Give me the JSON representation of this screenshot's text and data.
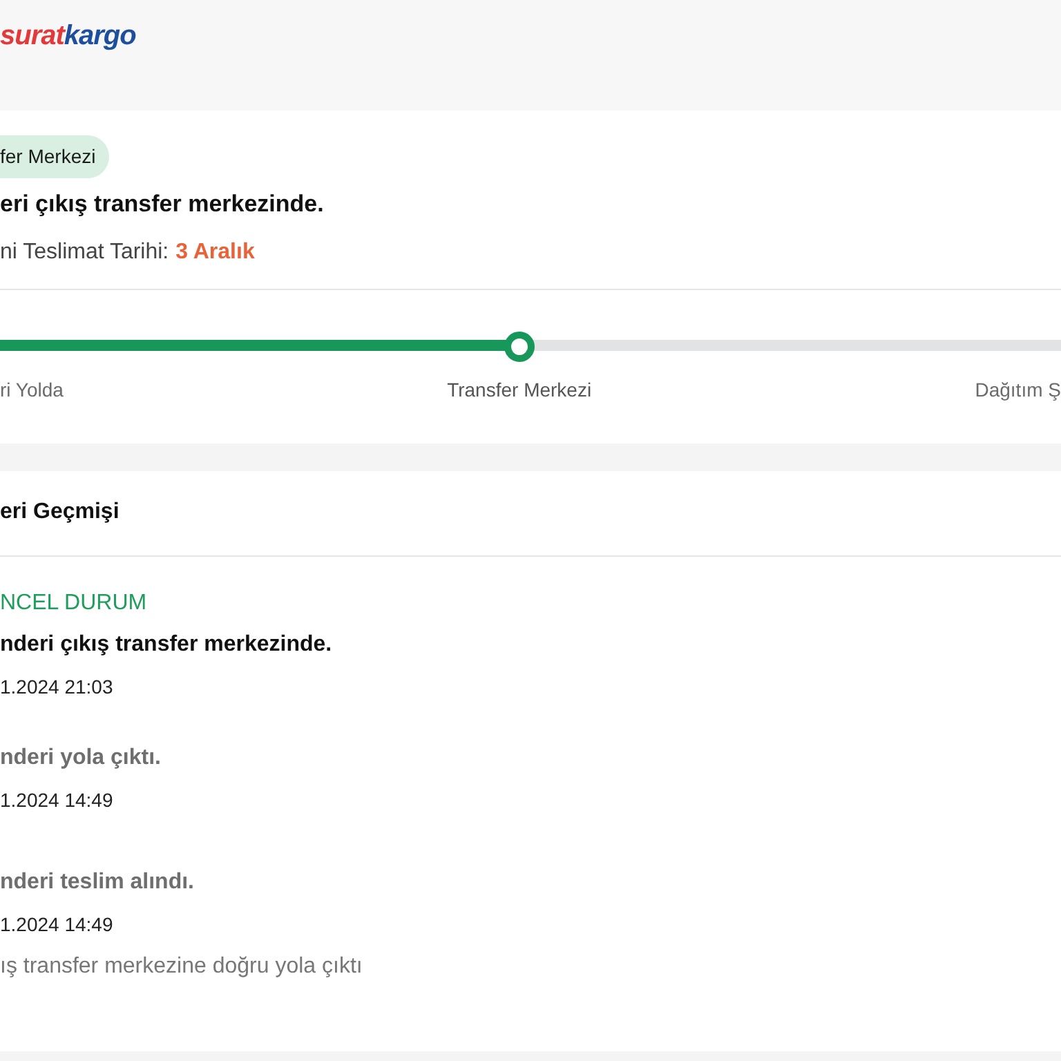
{
  "logo": {
    "part_1": "surat",
    "part_2": "kargo"
  },
  "status": {
    "badge": "fer Merkezi",
    "message": "eri çıkış transfer merkezinde.",
    "date_label": "ni Teslimat Tarihi:",
    "date_value": "3 Aralık"
  },
  "progress": {
    "level": 0.49,
    "steps": [
      {
        "label": "ri Yolda",
        "current": false
      },
      {
        "label": "Transfer Merkezi",
        "current": true
      },
      {
        "label": "Dağıtım Ş",
        "current": false
      }
    ]
  },
  "history": {
    "title": "eri Geçmişi",
    "events": [
      {
        "tag": "NCEL DURUM",
        "text": "nderi çıkış transfer merkezinde.",
        "time": "1.2024 21:03",
        "current": true
      },
      {
        "text": "nderi yola çıktı.",
        "time": "1.2024 14:49",
        "current": false
      },
      {
        "text": "nderi teslim alındı.",
        "time": "1.2024 14:49",
        "note": "ış transfer merkezine doğru yola çıktı",
        "current": false
      }
    ]
  }
}
